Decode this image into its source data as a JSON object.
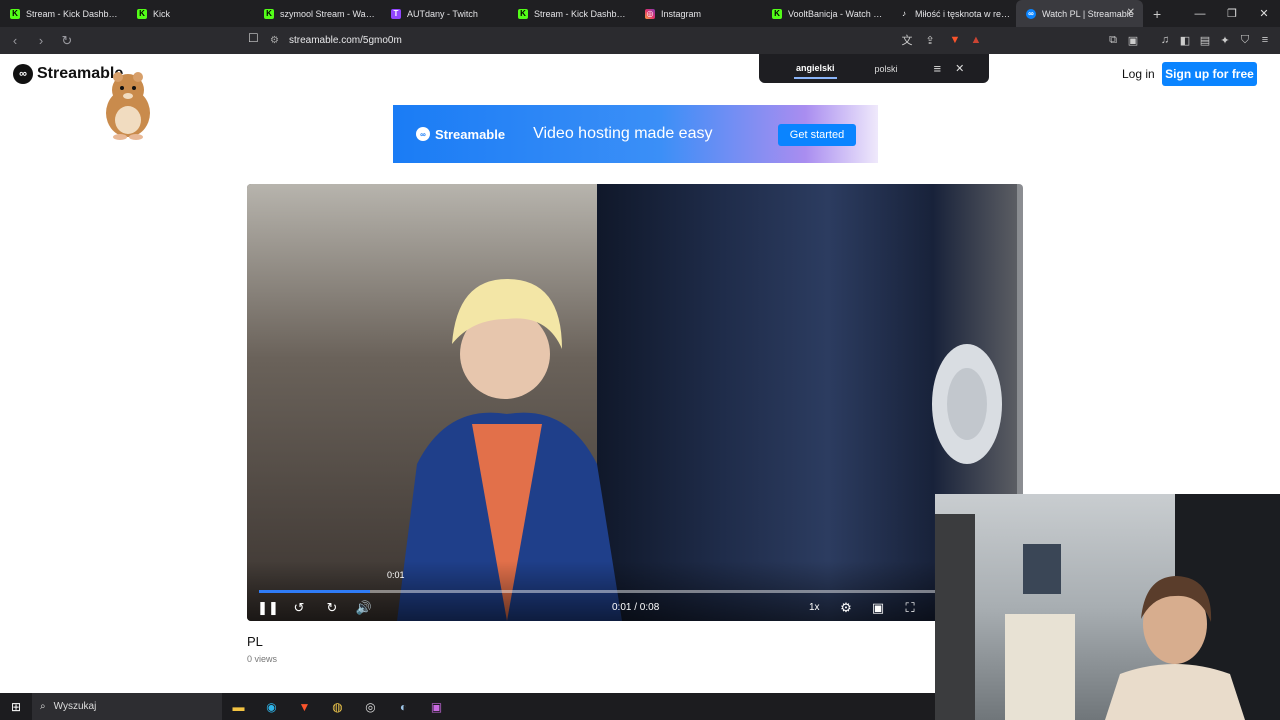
{
  "tabs": [
    {
      "title": "Stream - Kick Dashboard",
      "icon": "kick-icon",
      "color": "#53fc18"
    },
    {
      "title": "Kick",
      "icon": "kick-icon",
      "color": "#53fc18"
    },
    {
      "title": "szymool Stream - Watch Li",
      "icon": "kick-icon",
      "color": "#53fc18"
    },
    {
      "title": "AUTdany - Twitch",
      "icon": "twitch-icon",
      "color": "#9146ff"
    },
    {
      "title": "Stream - Kick Dashboard",
      "icon": "kick-icon",
      "color": "#53fc18"
    },
    {
      "title": "Instagram",
      "icon": "instagram-icon",
      "color": "#e1306c"
    },
    {
      "title": "VooltBanicja - Watch clips",
      "icon": "kick-icon",
      "color": "#53fc18"
    },
    {
      "title": "Miłość i tęsknota w relacji",
      "icon": "tiktok-icon",
      "color": "#ffffff"
    },
    {
      "title": "Watch PL | Streamable",
      "icon": "streamable-icon",
      "color": "#0a84ff",
      "active": true
    }
  ],
  "url": "streamable.com/5gmo0m",
  "translate": {
    "lang_from": "angielski",
    "lang_to": "polski"
  },
  "header": {
    "logo": "Streamable",
    "login": "Log in",
    "signup": "Sign up for free"
  },
  "banner": {
    "logo": "Streamable",
    "tagline": "Video hosting made easy",
    "cta": "Get started"
  },
  "player": {
    "hover_time": "0:01",
    "time": "0:01 / 0:08",
    "speed": "1x",
    "progress": 0.147
  },
  "video": {
    "title": "PL",
    "views": "0 views"
  },
  "taskbar": {
    "search": "Wyszukaj"
  },
  "colors": {
    "accent": "#0a84ff",
    "seek": "#2f7cf6"
  }
}
